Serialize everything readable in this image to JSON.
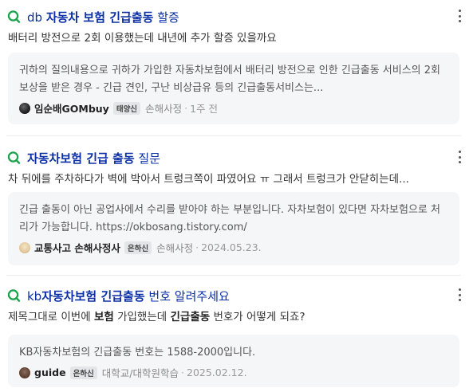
{
  "results": [
    {
      "title_prefix": "db ",
      "title_bold": "자동차 보험 긴급출동",
      "title_suffix": " 할증",
      "question": "배터리 방전으로 2회 이용했는데 내년에 추가 할증 있을까요",
      "answer": "귀하의 질의내용으로 귀하가 가입한 자동차보험에서 배터리 방전으로 인한 긴급출동 서비스의 2회 보상을 받은 경우 - 긴급 견인, 구난 비상급유 등의 긴급출동서비스는...",
      "author": "임순배GOMbuy",
      "badge": "태양신",
      "category": "손해사정",
      "time": "1주 전"
    },
    {
      "title_bold": "자동차보험 긴급 출동",
      "title_suffix": " 질문",
      "question": "차 뒤에를 주차하다가 벽에 박아서 트렁크쪽이 파였어요 ㅠ 그래서 트렁크가 안닫히는데...",
      "answer": "긴급 출동이 아닌 공업사에서 수리를 받아야 하는 부분입니다. 자차보험이 있다면 자차보험으로 처리가 가능합니다. https://okbosang.tistory.com/",
      "author": "교통사고 손해사정사",
      "badge": "은하신",
      "category": "손해사정",
      "time": "2024.05.23."
    },
    {
      "title_prefix": "kb",
      "title_bold": "자동차보험 긴급출동",
      "title_suffix": " 번호 알려주세요",
      "question_pre": "제목그대로 이번에 ",
      "question_b1": "보험",
      "question_mid": " 가입했는데 ",
      "question_b2": "긴급출동",
      "question_post": " 번호가 어떻게 되죠?",
      "answer": "KB자동차보험의 긴급출동 번호는 1588-2000입니다.",
      "author": "guide",
      "badge": "은하신",
      "category": "대학교/대학원학습",
      "time": "2025.02.12."
    }
  ],
  "icons": {
    "search_q": "q-search-icon",
    "more": "more-vertical-icon"
  },
  "colors": {
    "title": "#0b2fa5",
    "q_icon": "#19a34a",
    "answer_bg": "#f5f6f8"
  }
}
